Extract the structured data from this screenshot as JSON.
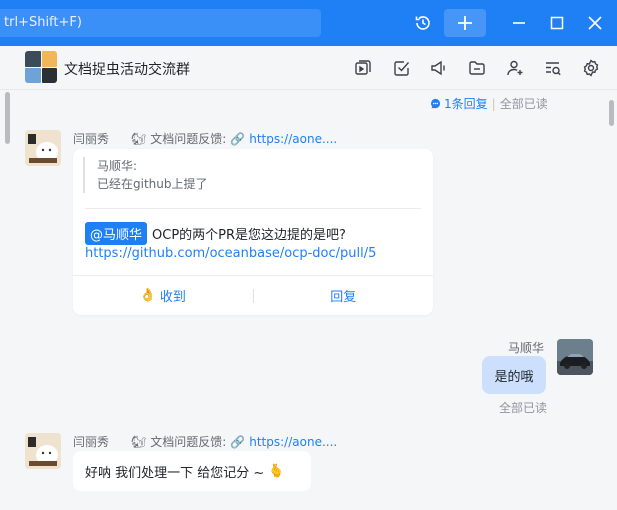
{
  "topbar": {
    "search_placeholder": "trl+Shift+F)",
    "history_icon": "history-icon",
    "add_icon": "plus-icon",
    "minimize_icon": "minimize-icon",
    "maximize_icon": "maximize-icon",
    "close_icon": "close-icon"
  },
  "header": {
    "group_name": "文档捉虫活动交流群",
    "icons": [
      "screen-share-icon",
      "task-icon",
      "announcement-icon",
      "folder-icon",
      "add-member-icon",
      "search-history-icon",
      "settings-icon"
    ]
  },
  "thread_meta": {
    "reply_count": "1条回复",
    "read_status": "全部已读"
  },
  "message1": {
    "sender": "闫丽秀",
    "topic": "文档问题反馈:",
    "topic_link": "https://aone....",
    "quote_author": "马顺华:",
    "quote_text": "已经在github上提了",
    "mention": "@马顺华",
    "text": "OCP的两个PR是您这边提的是吧?",
    "link": "https://github.com/oceanbase/ocp-doc/pull/5",
    "ack_label": "收到",
    "reply_label": "回复"
  },
  "message2": {
    "sender": "马顺华",
    "text": "是的哦",
    "read_status": "全部已读"
  },
  "message3": {
    "sender": "闫丽秀",
    "topic": "文档问题反馈:",
    "topic_link": "https://aone....",
    "text": "好呐 我们处理一下 给您记分 ~"
  },
  "colors": {
    "accent": "#1f80f5",
    "my_bubble": "#cce0fd",
    "background": "#f5f6f7"
  }
}
